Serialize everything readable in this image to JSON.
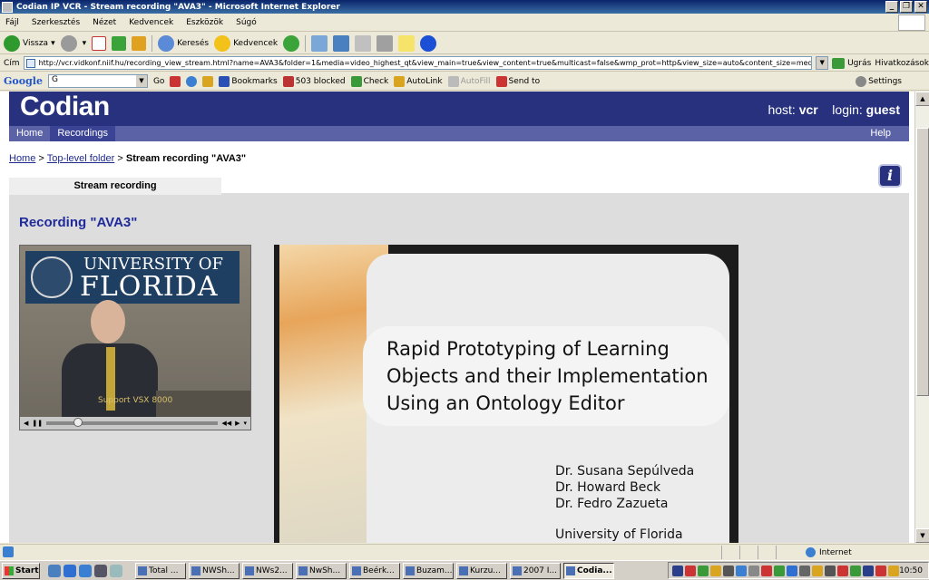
{
  "window": {
    "title": "Codian IP VCR - Stream recording \"AVA3\" - Microsoft Internet Explorer"
  },
  "menu": [
    "Fájl",
    "Szerkesztés",
    "Nézet",
    "Kedvencek",
    "Eszközök",
    "Súgó"
  ],
  "toolbar": {
    "back_label": "Vissza",
    "search_label": "Keresés",
    "favorites_label": "Kedvencek"
  },
  "address": {
    "label": "Cím",
    "url": "http://vcr.vidkonf.niif.hu/recording_view_stream.html?name=AVA3&folder=1&media=video_highest_qt&view_main=true&view_content=true&multicast=false&wmp_prot=http&view_size=auto&content_size=medium",
    "go_label": "Ugrás",
    "links_label": "Hivatkozások"
  },
  "google_bar": {
    "logo": "Google",
    "search_value": "G",
    "go_label": "Go",
    "bookmarks_label": "Bookmarks",
    "blocked_label": "503 blocked",
    "check_label": "Check",
    "autolink_label": "AutoLink",
    "autofill_label": "AutoFill",
    "sendto_label": "Send to",
    "settings_label": "Settings"
  },
  "codian": {
    "logo": "Codian",
    "host_label": "host:",
    "host_value": "vcr",
    "login_label": "login:",
    "login_value": "guest",
    "nav": {
      "home": "Home",
      "recordings": "Recordings",
      "help": "Help"
    },
    "breadcrumb": {
      "home": "Home",
      "sep1": ">",
      "folder": "Top-level folder",
      "sep2": ">",
      "current": "Stream recording \"AVA3\""
    },
    "info_icon": "i",
    "tab_label": "Stream recording",
    "recording_title": "Recording \"AVA3\""
  },
  "video": {
    "banner_line1": "UNIVERSITY OF",
    "banner_line2": "FLORIDA",
    "overlay": "Support VSX 8000"
  },
  "slide": {
    "title_lines": [
      "Rapid Prototyping of Learning",
      "Objects and their Implementation",
      "Using an Ontology Editor"
    ],
    "authors": [
      "Dr. Susana Sepúlveda",
      "Dr. Howard Beck",
      "Dr. Fedro Zazueta"
    ],
    "institution": "University of Florida"
  },
  "status": {
    "zone": "Internet"
  },
  "taskbar": {
    "start": "Start",
    "tasks": [
      {
        "label": "Total ...",
        "active": false
      },
      {
        "label": "NWSh...",
        "active": false
      },
      {
        "label": "NWs2...",
        "active": false
      },
      {
        "label": "NwSh...",
        "active": false
      },
      {
        "label": "Beérk...",
        "active": false
      },
      {
        "label": "Buzam...",
        "active": false
      },
      {
        "label": "Kurzu...",
        "active": false
      },
      {
        "label": "2007 I...",
        "active": false
      },
      {
        "label": "Codia...",
        "active": true
      }
    ],
    "clock": "10:50"
  },
  "colors": {
    "codian_header": "#27317e",
    "codian_nav": "#5b63a6",
    "link": "#1f2b8a",
    "recording_title": "#1f2b9a"
  }
}
